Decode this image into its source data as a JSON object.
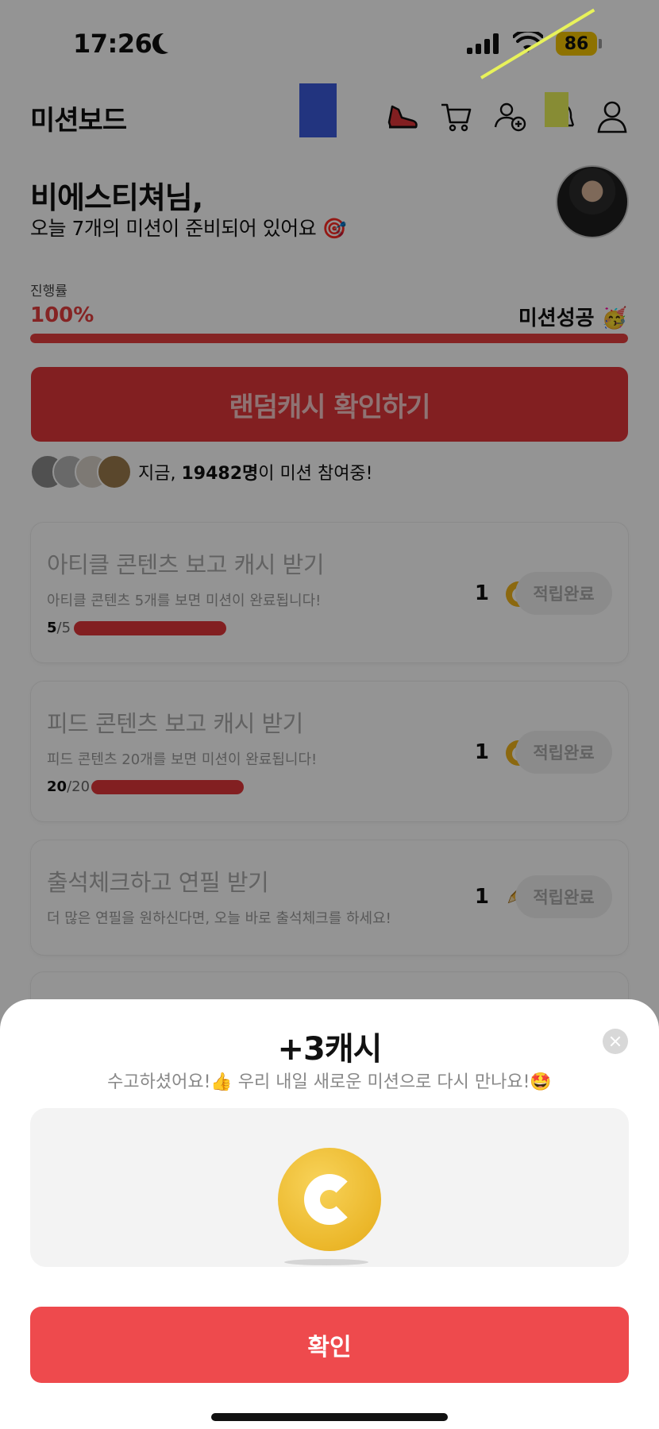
{
  "status_bar": {
    "time": "17:26",
    "battery": "86"
  },
  "header": {
    "title": "미션보드"
  },
  "greeting": {
    "name": "비에스티쳐님,",
    "subtitle": "오늘 7개의 미션이 준비되어 있어요 🎯"
  },
  "progress": {
    "label": "진행률",
    "value": "100%",
    "done_label": "미션성공 🥳",
    "fraction": 1.0
  },
  "random_cash_button": "랜덤캐시 확인하기",
  "participants": {
    "prefix": "지금, ",
    "count": "19482명",
    "suffix": "이 미션 참여중!"
  },
  "missions": [
    {
      "title": "아티클 콘텐츠 보고 캐시 받기",
      "desc": "아티클 콘텐츠 5개를 보면 미션이 완료됩니다!",
      "count_done": "5",
      "count_total": "/5",
      "reward": "1",
      "reward_icon": "coin-icon",
      "button": "적립완료"
    },
    {
      "title": "피드 콘텐츠 보고 캐시 받기",
      "desc": "피드 콘텐츠 20개를 보면 미션이 완료됩니다!",
      "count_done": "20",
      "count_total": "/20",
      "reward": "1",
      "reward_icon": "coin-icon",
      "button": "적립완료"
    },
    {
      "title": "출석체크하고 연필 받기",
      "desc": "더 많은 연필을 원하신다면, 오늘 바로 출석체크를 하세요!",
      "reward": "1",
      "reward_icon": "pencil-icon",
      "button": "적립완료"
    }
  ],
  "sheet": {
    "title": "+3캐시",
    "subtitle": "수고하셨어요!👍 우리 내일 새로운 미션으로 다시 만나요!🤩",
    "confirm": "확인"
  },
  "colors": {
    "accent": "#e53e3e",
    "confirm": "#ee4a4d",
    "coin": "#f0b41a"
  }
}
